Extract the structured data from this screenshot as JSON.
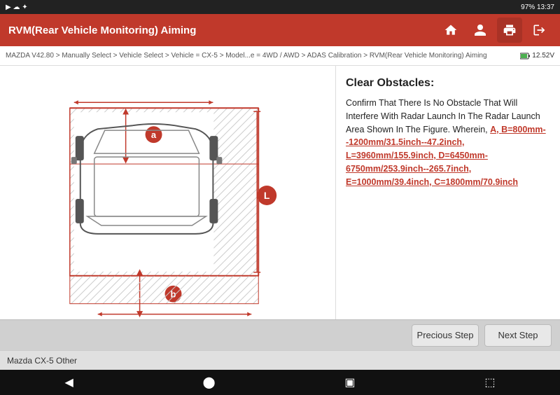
{
  "statusBar": {
    "leftIcons": "▶ ☁",
    "rightText": "97%  13:37"
  },
  "header": {
    "title": "RVM(Rear Vehicle Monitoring) Aiming",
    "icons": [
      "🏠",
      "👤",
      "🖨",
      "⬆"
    ]
  },
  "breadcrumb": {
    "text": "MAZDA V42.80 > Manually Select > Vehicle Select > Vehicle = CX-5 > Model...e = 4WD / AWD > ADAS Calibration > RVM(Rear Vehicle Monitoring) Aiming",
    "battery": "12.52V"
  },
  "textPanel": {
    "title": "Clear Obstacles:",
    "intro": "Confirm That There Is No Obstacle That Will Interfere With Radar Launch In The Radar Launch Area Shown In The Figure. Wherein, ",
    "highlightStart": "A, ",
    "measurements": "B=800mm--1200mm/31.5inch--47.2inch, L=3960mm/155.9inch, D=6450mm-6750mm/253.9inch--265.7inch, E=1000mm/39.4inch, C=1800mm/70.9inch"
  },
  "buttons": {
    "previous": "Precious Step",
    "next": "Next Step"
  },
  "bottomBar": {
    "text": "Mazda CX-5 Other"
  },
  "labels": {
    "a": "a",
    "b": "b",
    "L": "L"
  }
}
